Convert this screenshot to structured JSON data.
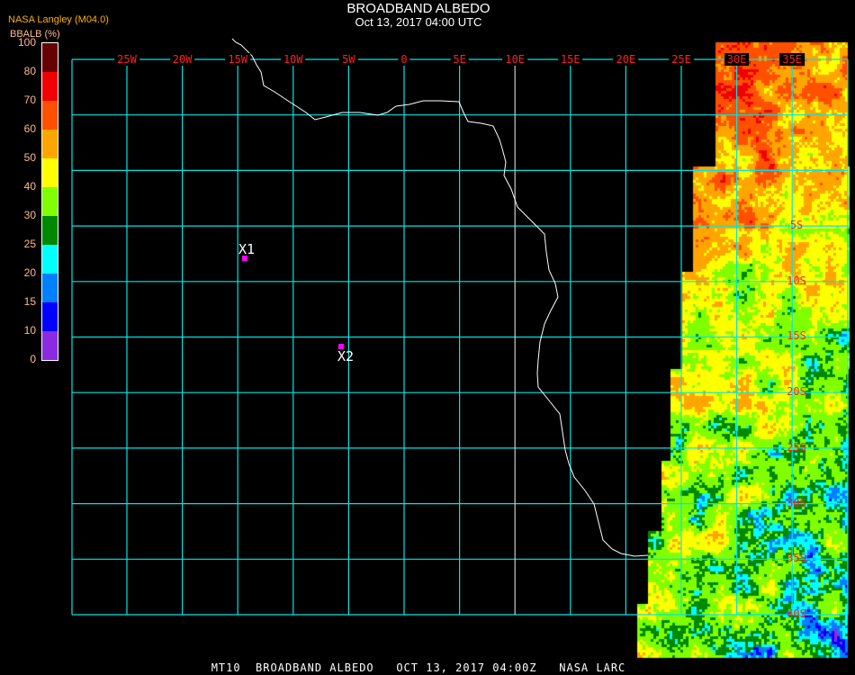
{
  "header": {
    "title": "BROADBAND ALBEDO",
    "subtitle": "Oct 13, 2017 04:00 UTC",
    "source": "NASA Langley (M04.0)"
  },
  "colorbar": {
    "units": "BBALB (%)",
    "labels": [
      "100",
      "80",
      "70",
      "60",
      "50",
      "40",
      "30",
      "25",
      "20",
      "15",
      "10",
      "0"
    ],
    "colors": [
      "#660000",
      "#f00000",
      "#ff5000",
      "#ffa500",
      "#ffff00",
      "#80ff00",
      "#008800",
      "#00ffff",
      "#0080ff",
      "#0000ff",
      "#8a2be2"
    ]
  },
  "map": {
    "lon_labels": [
      "25W",
      "20W",
      "15W",
      "10W",
      "5W",
      "0",
      "5E",
      "10E",
      "15E",
      "20E",
      "25E",
      "30E",
      "35E"
    ],
    "lat_labels": [
      "5S",
      "10S",
      "15S",
      "20S",
      "25S",
      "30S",
      "35S",
      "40S"
    ],
    "grid_color": "#00e5e5",
    "markers": [
      {
        "label": "X1"
      },
      {
        "label": "X2"
      }
    ]
  },
  "footer": "MT10  BROADBAND ALBEDO   OCT 13, 2017 04:00Z   NASA LARC"
}
